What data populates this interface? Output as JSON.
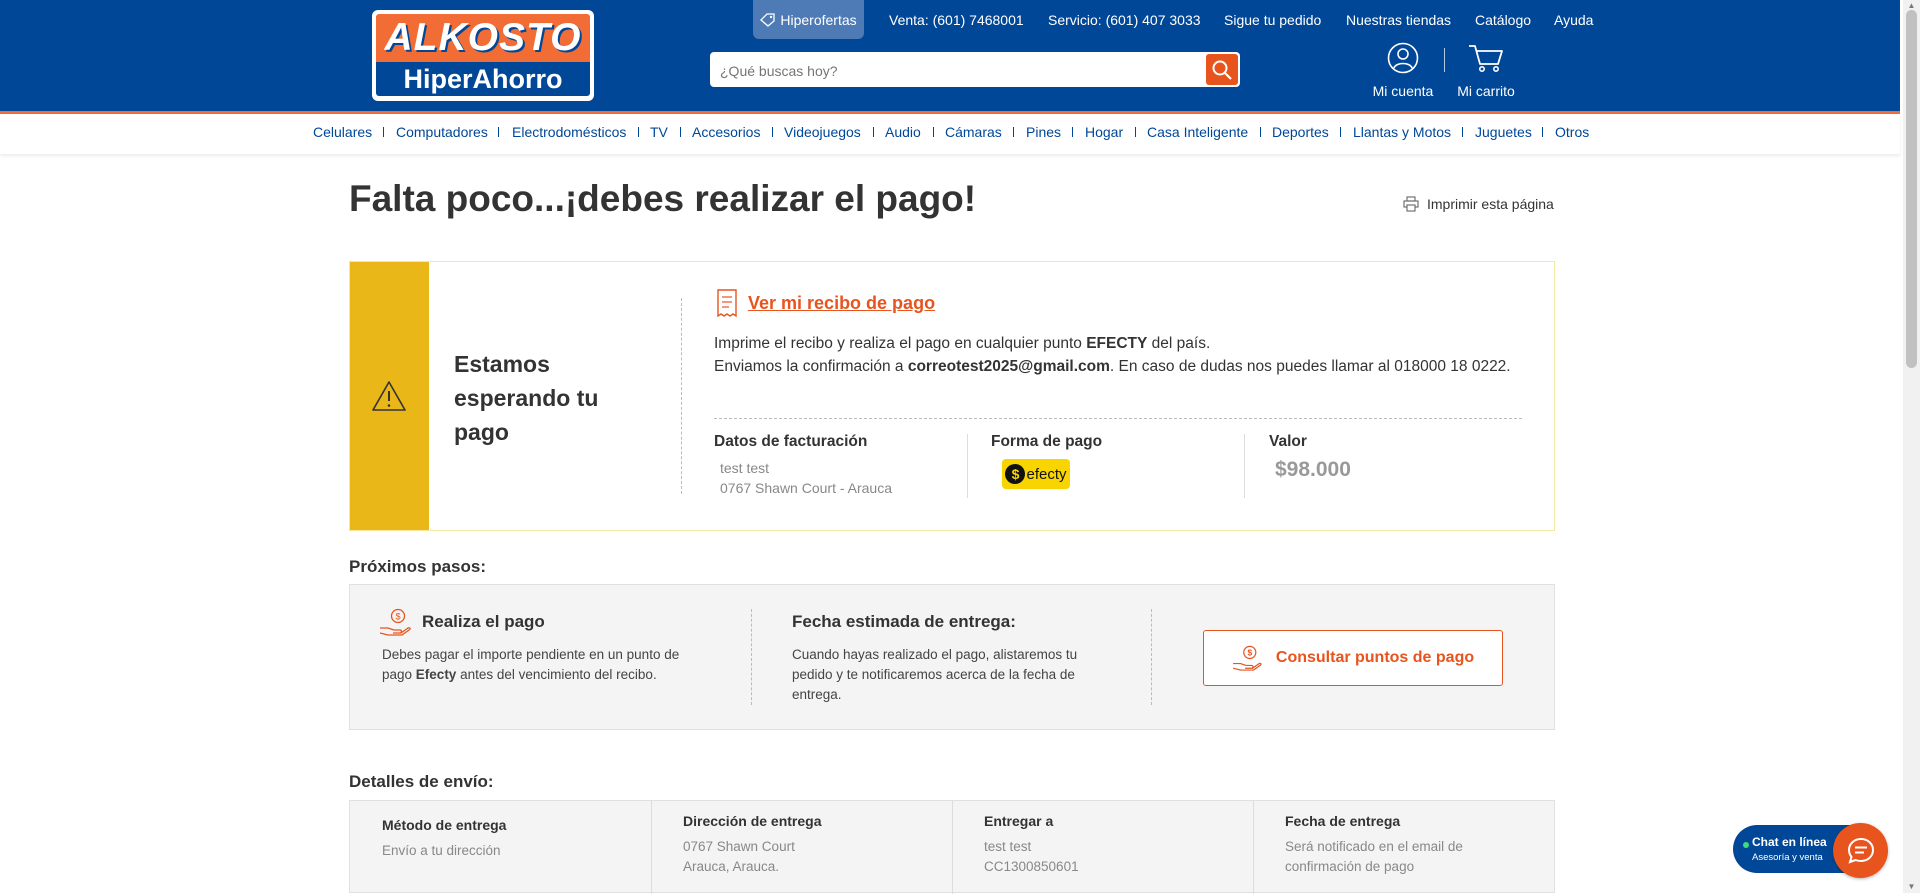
{
  "header": {
    "logo_top": "ALKOSTO",
    "logo_bottom": "HiperAhorro",
    "hiperofertas": "Hiperofertas",
    "venta": "Venta: (601) 7468001",
    "servicio": "Servicio: (601) 407 3033",
    "links": [
      "Sigue tu pedido",
      "Nuestras tiendas",
      "Catálogo",
      "Ayuda"
    ],
    "search_placeholder": "¿Qué buscas hoy?",
    "account_label": "Mi cuenta",
    "cart_label": "Mi carrito"
  },
  "categories": [
    "Celulares",
    "Computadores",
    "Electrodomésticos",
    "TV",
    "Accesorios",
    "Videojuegos",
    "Audio",
    "Cámaras",
    "Pines",
    "Hogar",
    "Casa Inteligente",
    "Deportes",
    "Llantas y Motos",
    "Juguetes",
    "Otros"
  ],
  "page": {
    "title": "Falta poco...¡debes realizar el pago!",
    "print_label": "Imprimir esta página"
  },
  "status_box": {
    "title": "Estamos esperando tu pago",
    "receipt_link": "Ver mi recibo de pago",
    "line1_prefix": "Imprime el recibo y realiza el pago en cualquier punto ",
    "line1_bold": "EFECTY",
    "line1_suffix": " del país.",
    "line2_prefix": "Enviamos la confirmación a ",
    "line2_email": "correotest2025@gmail.com",
    "line2_suffix": ". En caso de dudas nos puedes llamar al 018000 18 0222.",
    "billing_title": "Datos de facturación",
    "billing_name": "test test",
    "billing_address": "0767 Shawn Court - Arauca",
    "payment_title": "Forma de pago",
    "payment_logo": "efecty",
    "value_title": "Valor",
    "value": "$98.000"
  },
  "next_steps": {
    "title": "Próximos pasos:",
    "pay_title": "Realiza el pago",
    "pay_text_prefix": "Debes pagar el importe pendiente en un punto de pago ",
    "pay_text_bold": "Efecty",
    "pay_text_suffix": " antes del vencimiento del recibo.",
    "delivery_title": "Fecha estimada de entrega:",
    "delivery_text": "Cuando hayas realizado el pago, alistaremos tu pedido y te notificaremos acerca de la fecha de entrega.",
    "consult_button": "Consultar puntos de pago"
  },
  "shipping": {
    "title": "Detalles de envío:",
    "method_title": "Método de entrega",
    "method_value": "Envío a tu dirección",
    "address_title": "Dirección de entrega",
    "address_line1": "0767 Shawn Court",
    "address_line2": "Arauca, Arauca.",
    "deliver_to_title": "Entregar a",
    "deliver_to_name": "test test",
    "deliver_to_id": "CC1300850601",
    "date_title": "Fecha de entrega",
    "date_value": "Será notificado en el email de confirmación de pago"
  },
  "chat": {
    "title": "Chat en línea",
    "subtitle": "Asesoría y venta"
  },
  "colors": {
    "brand_blue": "#004797",
    "brand_orange": "#e8541e",
    "warning_yellow": "#eab719",
    "efecty_yellow": "#f8d400"
  }
}
